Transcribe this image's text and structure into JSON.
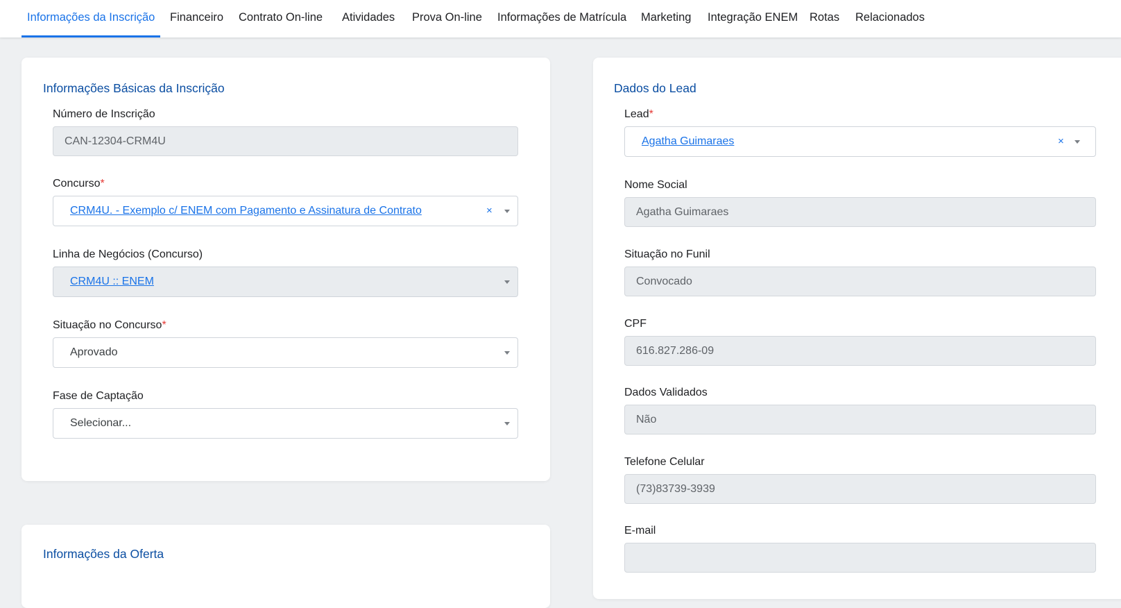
{
  "tabs": [
    {
      "label": "Informações da Inscrição",
      "active": true
    },
    {
      "label": "Financeiro"
    },
    {
      "label": "Contrato On-line"
    },
    {
      "label": "Atividades"
    },
    {
      "label": "Prova On-line"
    },
    {
      "label": "Informações de Matrícula"
    },
    {
      "label": "Marketing"
    },
    {
      "label": "Integração ENEM"
    },
    {
      "label": "Rotas"
    },
    {
      "label": "Relacionados"
    }
  ],
  "basic": {
    "title": "Informações Básicas da Inscrição",
    "numero_label": "Número de Inscrição",
    "numero_value": "CAN-12304-CRM4U",
    "concurso_label": "Concurso",
    "concurso_value": "CRM4U. - Exemplo c/ ENEM com Pagamento e Assinatura de Contrato",
    "linha_label": "Linha de Negócios (Concurso)",
    "linha_value": "CRM4U :: ENEM",
    "situacao_label": "Situação no Concurso",
    "situacao_value": "Aprovado",
    "fase_label": "Fase de Captação",
    "fase_placeholder": "Selecionar..."
  },
  "lead": {
    "title": "Dados do Lead",
    "lead_label": "Lead",
    "lead_value": "Agatha Guimaraes",
    "nome_label": "Nome Social",
    "nome_value": "Agatha Guimaraes",
    "funil_label": "Situação no Funil",
    "funil_value": "Convocado",
    "cpf_label": "CPF",
    "cpf_value": "616.827.286-09",
    "validados_label": "Dados Validados",
    "validados_value": "Não",
    "telefone_label": "Telefone Celular",
    "telefone_value": "(73)83739-3939",
    "email_label": "E-mail"
  },
  "next_card": {
    "title_partial": "Informações da Oferta"
  },
  "symbols": {
    "required": "*",
    "clear": "×"
  },
  "colors": {
    "accent": "#1a73e8",
    "title": "#0b4ea2",
    "required": "#e53935",
    "background": "#eef0f2"
  }
}
